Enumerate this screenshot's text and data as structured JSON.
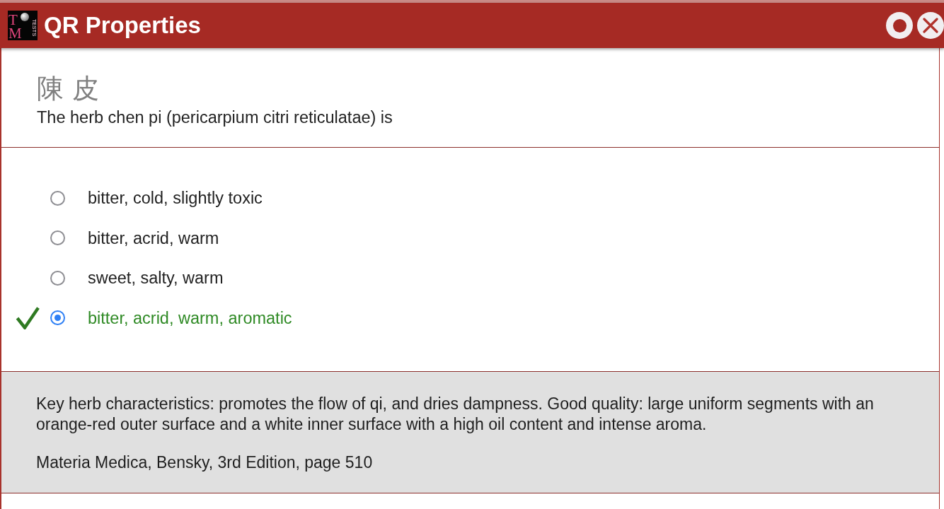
{
  "window": {
    "title": "QR Properties",
    "logo": {
      "letters": [
        "T",
        "M"
      ],
      "tagline": "TESTS"
    }
  },
  "question": {
    "herb_characters": "陳 皮",
    "prompt": "The herb chen pi (pericarpium citri reticulatae) is"
  },
  "options": [
    {
      "label": "bitter, cold, slightly toxic",
      "selected": false,
      "correct": false
    },
    {
      "label": "bitter, acrid, warm",
      "selected": false,
      "correct": false
    },
    {
      "label": "sweet, salty, warm",
      "selected": false,
      "correct": false
    },
    {
      "label": "bitter, acrid, warm, aromatic",
      "selected": true,
      "correct": true
    }
  ],
  "explanation": {
    "text": "Key herb characteristics: promotes the flow of qi, and dries dampness. Good quality: large uniform segments with an orange-red outer surface and a white inner surface with a high oil content and intense aroma.",
    "reference": "Materia Medica, Bensky, 3rd Edition, page 510"
  }
}
